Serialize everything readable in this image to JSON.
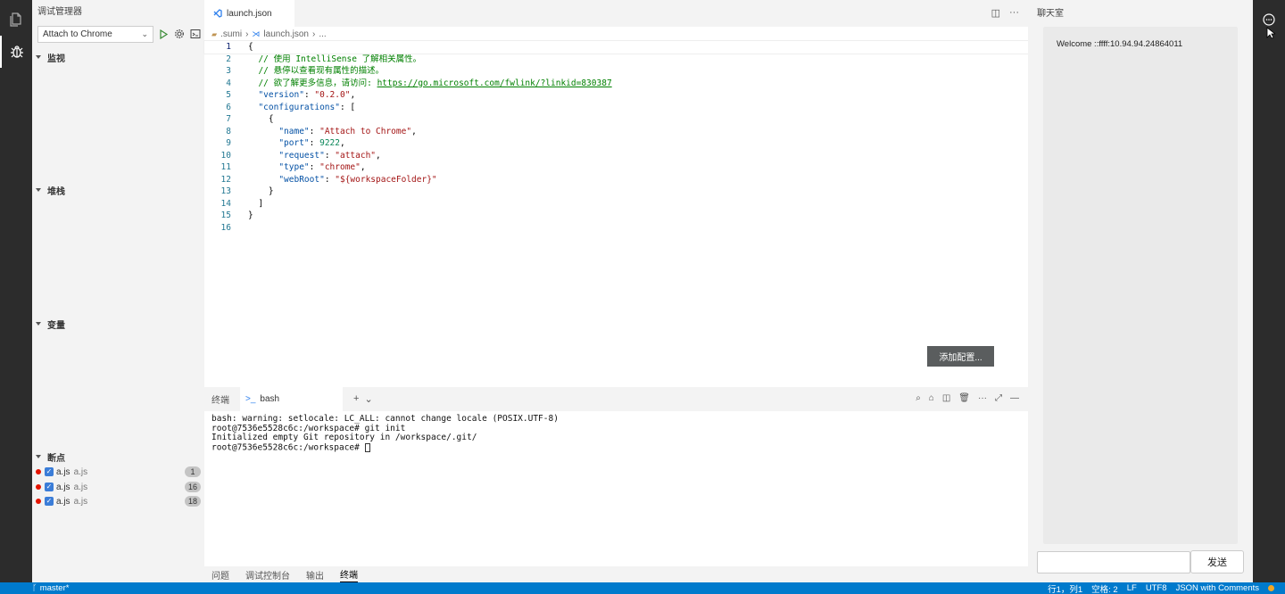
{
  "sidebar": {
    "title": "调试管理器",
    "config_select": "Attach to Chrome",
    "sections": {
      "watch": "监视",
      "callstack": "堆栈",
      "variables": "变量",
      "breakpoints": "断点"
    },
    "breakpoints": [
      {
        "name": "a.js",
        "desc": "a.js",
        "line": "1"
      },
      {
        "name": "a.js",
        "desc": "a.js",
        "line": "16"
      },
      {
        "name": "a.js",
        "desc": "a.js",
        "line": "18"
      }
    ]
  },
  "editor": {
    "tab_label": "launch.json",
    "breadcrumb": [
      ".sumi",
      "launch.json",
      "..."
    ],
    "add_config_button": "添加配置...",
    "line_numbers": [
      "1",
      "2",
      "3",
      "4",
      "5",
      "6",
      "7",
      "8",
      "9",
      "10",
      "11",
      "12",
      "13",
      "14",
      "15",
      "16"
    ],
    "code": {
      "l1": "{",
      "l2": "// 使用 IntelliSense 了解相关属性。",
      "l3": "// 悬停以查看现有属性的描述。",
      "l4_prefix": "// 欲了解更多信息，请访问: ",
      "l4_link": "https://go.microsoft.com/fwlink/?linkid=830387",
      "l5_key": "\"version\"",
      "l5_val": "\"0.2.0\"",
      "l6_key": "\"configurations\"",
      "l6_tail": "[",
      "l7": "{",
      "l8_key": "\"name\"",
      "l8_val": "\"Attach to Chrome\"",
      "l9_key": "\"port\"",
      "l9_val": "9222",
      "l10_key": "\"request\"",
      "l10_val": "\"attach\"",
      "l11_key": "\"type\"",
      "l11_val": "\"chrome\"",
      "l12_key": "\"webRoot\"",
      "l12_val": "\"${workspaceFolder}\"",
      "l13": "}",
      "l14": "]",
      "l15": "}",
      "l16": ""
    }
  },
  "panel": {
    "header_label": "终端",
    "terminal_tab": "bash",
    "plus": "+",
    "lines": [
      "bash: warning: setlocale: LC_ALL: cannot change locale (POSIX.UTF-8)",
      "root@7536e5528c6c:/workspace# git init",
      "Initialized empty Git repository in /workspace/.git/",
      "root@7536e5528c6c:/workspace# "
    ],
    "tabs": [
      "问题",
      "调试控制台",
      "输出",
      "终端"
    ]
  },
  "chat": {
    "title": "聊天室",
    "message": "Welcome ::ffff:10.94.94.24864011",
    "send_button": "发送"
  },
  "statusbar": {
    "branch": "master*",
    "position": "行1，列1",
    "spaces": "空格: 2",
    "eol": "LF",
    "encoding": "UTF8",
    "language": "JSON with Comments"
  },
  "colors": {
    "accent": "#007acc",
    "activity_bar": "#2c2c2c",
    "breakpoint": "#e51400"
  }
}
